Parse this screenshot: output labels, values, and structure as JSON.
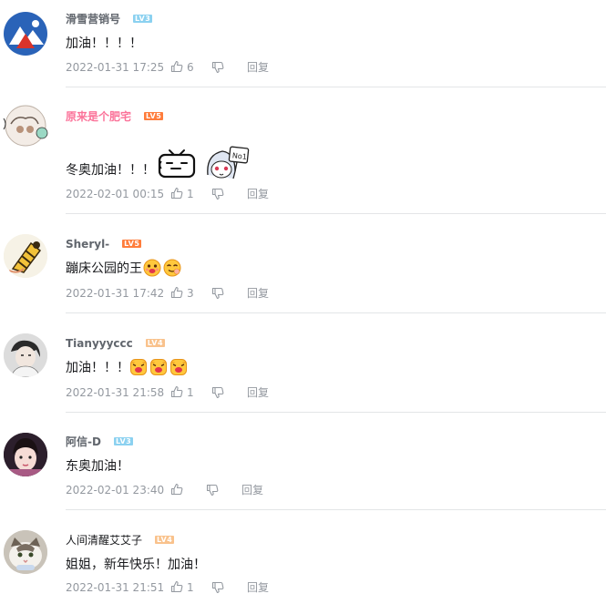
{
  "comments": [
    {
      "user": "滑雪营销号",
      "level": "LV3",
      "text": "加油！！！！",
      "time": "2022-01-31 17:25",
      "likes": "6",
      "reply": "回复"
    },
    {
      "user": "原来是个肥宅",
      "level": "LV5",
      "text": "冬奥加油！！！",
      "time": "2022-02-01 00:15",
      "likes": "1",
      "reply": "回复",
      "sticker_text": "No1"
    },
    {
      "user": "Sheryl-",
      "level": "LV5",
      "text": "蹦床公园的王",
      "time": "2022-01-31 17:42",
      "likes": "3",
      "reply": "回复"
    },
    {
      "user": "Tianyyyccc",
      "level": "LV4",
      "text": "加油！！！",
      "time": "2022-01-31 21:58",
      "likes": "1",
      "reply": "回复"
    },
    {
      "user": "阿信-D",
      "level": "LV3",
      "text": "东奥加油！",
      "time": "2022-02-01 23:40",
      "likes": "",
      "reply": "回复"
    },
    {
      "user": "人间清醒艾艾子",
      "level": "LV4",
      "text": "姐姐，新年快乐！加油！",
      "time": "2022-01-31 21:51",
      "likes": "1",
      "reply": "回复"
    }
  ],
  "colors": {
    "username": "#61666d",
    "username_vip": "#fb7299",
    "meta": "#9499a0",
    "divider": "#e3e5e7",
    "lv3": "#8bd1f0",
    "lv4": "#f9c28c",
    "lv5": "#ff7d3c"
  },
  "icons": {
    "like": "thumbs-up-icon",
    "dislike": "thumbs-down-icon",
    "emoji": "emoji-icon",
    "sticker": "sticker-icon"
  }
}
